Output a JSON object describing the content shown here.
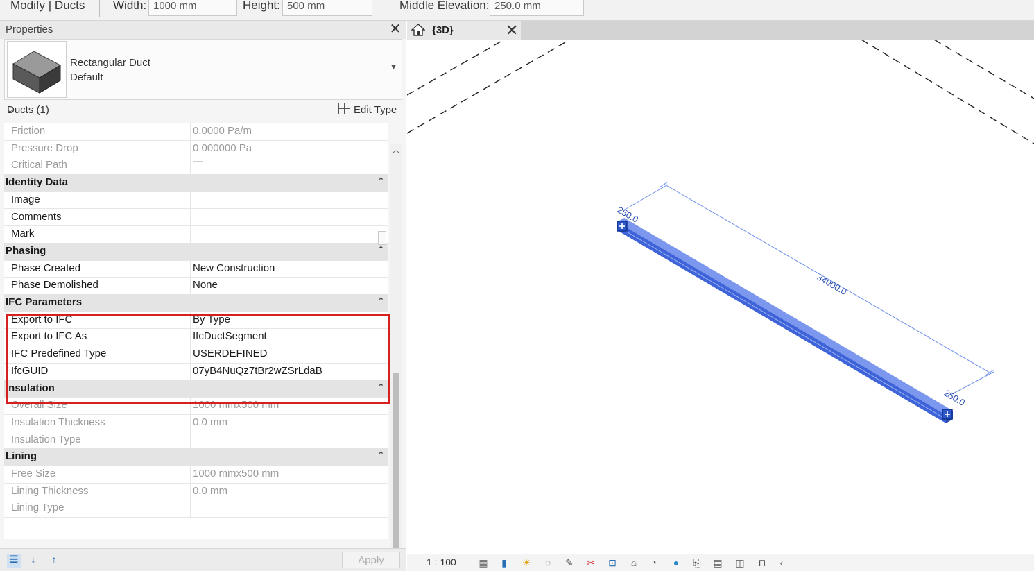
{
  "options_bar": {
    "context": "Modify | Ducts",
    "width_label": "Width:",
    "width_value": "1000 mm",
    "height_label": "Height:",
    "height_value": "500 mm",
    "elevation_label": "Middle Elevation:",
    "elevation_value": "250.0 mm"
  },
  "properties": {
    "title": "Properties",
    "type_name": "Rectangular Duct",
    "type_sub": "Default",
    "filter": "Ducts (1)",
    "edit_type": "Edit Type",
    "apply": "Apply",
    "rows": {
      "friction": {
        "k": "Friction",
        "v": "0.0000 Pa/m"
      },
      "pressure_drop": {
        "k": "Pressure Drop",
        "v": "0.000000 Pa"
      },
      "critical_path": {
        "k": "Critical Path",
        "v": ""
      }
    },
    "identity": {
      "header": "Identity Data",
      "image": {
        "k": "Image",
        "v": ""
      },
      "comments": {
        "k": "Comments",
        "v": ""
      },
      "mark": {
        "k": "Mark",
        "v": ""
      }
    },
    "phasing": {
      "header": "Phasing",
      "created": {
        "k": "Phase Created",
        "v": "New Construction"
      },
      "demolished": {
        "k": "Phase Demolished",
        "v": "None"
      }
    },
    "ifc": {
      "header": "IFC Parameters",
      "export": {
        "k": "Export to IFC",
        "v": "By Type"
      },
      "export_as": {
        "k": "Export to IFC As",
        "v": "IfcDuctSegment"
      },
      "predefined": {
        "k": "IFC Predefined Type",
        "v": "USERDEFINED"
      },
      "guid": {
        "k": "IfcGUID",
        "v": "07yB4NuQz7tBr2wZSrLdaB"
      }
    },
    "insulation": {
      "header": "Insulation",
      "overall": {
        "k": "Overall Size",
        "v": "1000 mmx500 mm"
      },
      "thickness": {
        "k": "Insulation Thickness",
        "v": "0.0 mm"
      },
      "type": {
        "k": "Insulation Type",
        "v": ""
      }
    },
    "lining": {
      "header": "Lining",
      "free": {
        "k": "Free Size",
        "v": "1000 mmx500 mm"
      },
      "thickness": {
        "k": "Lining Thickness",
        "v": "0.0 mm"
      },
      "type": {
        "k": "Lining Type",
        "v": ""
      }
    }
  },
  "view": {
    "tab_label": "{3D}",
    "scale": "1 : 100",
    "dim_length": "34000.0",
    "dim_start": "250.0",
    "dim_end": "250.0"
  },
  "colors": {
    "highlight_border": "#d62020",
    "duct_blue": "#3f63d8",
    "dimension": "#6a8ee8"
  }
}
